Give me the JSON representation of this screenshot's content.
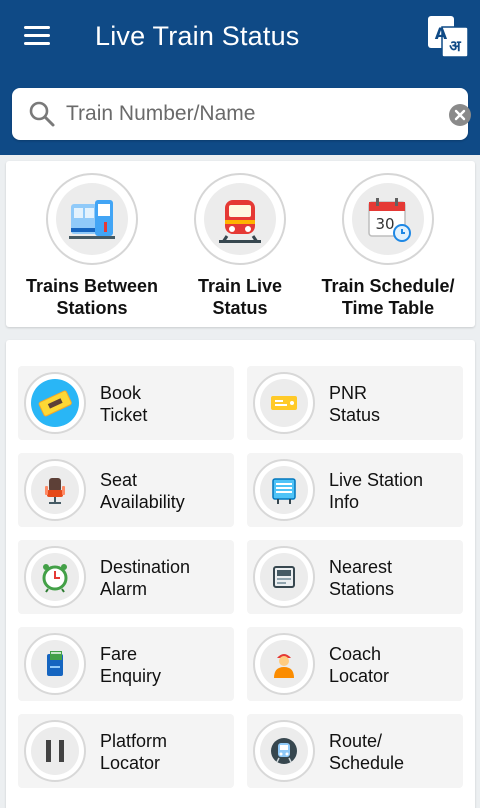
{
  "header": {
    "title": "Live Train Status",
    "lang_icon_text": "A",
    "lang_icon_text_hi": "अ",
    "bg_color": "#0f4a86"
  },
  "search": {
    "placeholder": "Train Number/Name",
    "value": ""
  },
  "top_items": [
    {
      "line1": "Trains Between",
      "line2": "Stations",
      "icon": "trains-between-icon"
    },
    {
      "line1": "Train Live",
      "line2": "Status",
      "icon": "live-train-icon"
    },
    {
      "line1": "Train Schedule/",
      "line2": "Time Table",
      "icon": "calendar-icon"
    }
  ],
  "calendar_day": "30",
  "tiles": [
    {
      "line1": "Book",
      "line2": "Ticket",
      "icon": "ticket-icon"
    },
    {
      "line1": "PNR",
      "line2": "Status",
      "icon": "pnr-ticket-icon"
    },
    {
      "line1": "Seat",
      "line2": "Availability",
      "icon": "seat-icon"
    },
    {
      "line1": "Live Station",
      "line2": "Info",
      "icon": "station-board-icon"
    },
    {
      "line1": "Destination",
      "line2": "Alarm",
      "icon": "alarm-clock-icon"
    },
    {
      "line1": "Nearest",
      "line2": "Stations",
      "icon": "nearest-station-icon"
    },
    {
      "line1": "Fare",
      "line2": "Enquiry",
      "icon": "fare-icon"
    },
    {
      "line1": "Coach",
      "line2": "Locator",
      "icon": "coach-person-icon"
    },
    {
      "line1": "Platform",
      "line2": "Locator",
      "icon": "platform-icon"
    },
    {
      "line1": "Route/",
      "line2": "Schedule",
      "icon": "route-train-icon"
    }
  ]
}
